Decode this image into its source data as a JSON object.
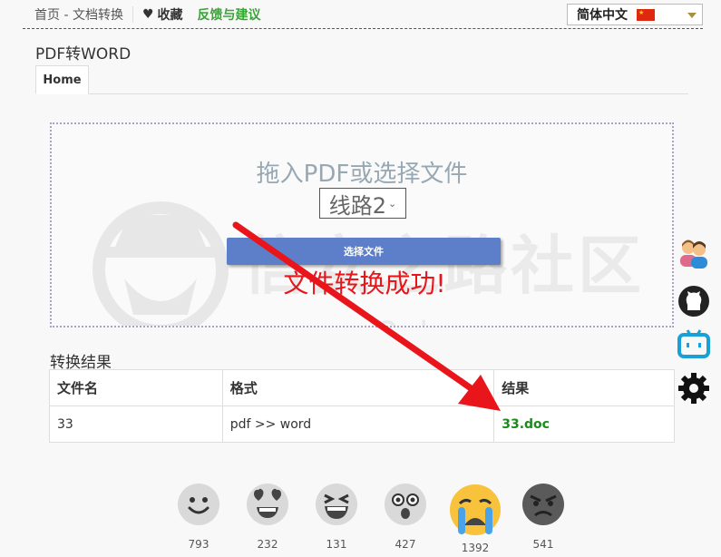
{
  "topbar": {
    "breadcrumb": "首页 - 文档转换",
    "favorite_label": "收藏",
    "feedback_label": "反馈与建议",
    "language": "简体中文"
  },
  "page": {
    "title": "PDF转WORD",
    "tab_home": "Home"
  },
  "dropzone": {
    "prompt": "拖入PDF或选择文件",
    "route_selected": "线路2",
    "choose_button": "选择文件",
    "success_message": "文件转换成功!"
  },
  "results": {
    "label": "转换结果",
    "headers": [
      "文件名",
      "格式",
      "结果"
    ],
    "rows": [
      {
        "filename": "33",
        "format": "pdf >> word",
        "result": "33.doc"
      }
    ]
  },
  "side_icons": [
    "users-icon",
    "github-icon",
    "bilibili-icon",
    "gear-icon"
  ],
  "reactions": [
    {
      "name": "smile-emoji",
      "count": "793"
    },
    {
      "name": "heart-eyes-emoji",
      "count": "232"
    },
    {
      "name": "laughing-emoji",
      "count": "131"
    },
    {
      "name": "shocked-emoji",
      "count": "427"
    },
    {
      "name": "crying-emoji",
      "count": "1392"
    },
    {
      "name": "angry-emoji",
      "count": "541"
    }
  ],
  "colors": {
    "accent_button": "#5d7fc9",
    "success_text": "#e8161b",
    "feedback_green": "#3aa335",
    "result_link": "#1b8a1b",
    "annotation_arrow": "#e8161b",
    "active_emoji": "#f9c23c"
  }
}
